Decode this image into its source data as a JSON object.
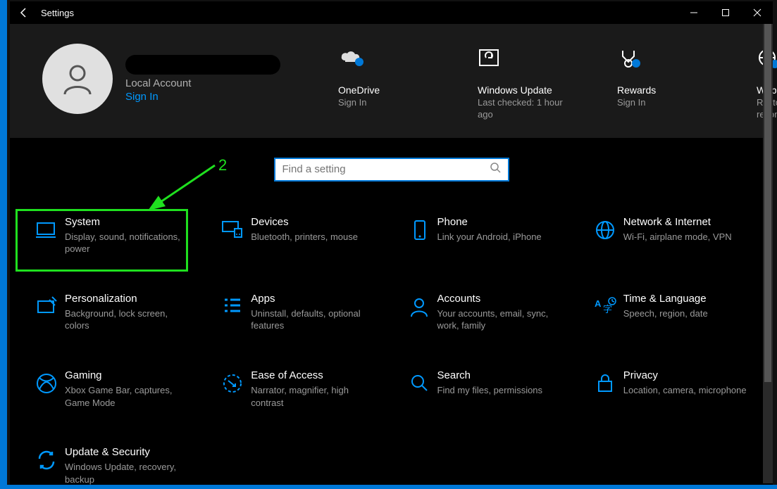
{
  "window": {
    "title": "Settings"
  },
  "user": {
    "account_type": "Local Account",
    "sign_in_label": "Sign In"
  },
  "status": [
    {
      "title": "OneDrive",
      "sub": "Sign In"
    },
    {
      "title": "Windows Update",
      "sub": "Last checked: 1 hour ago"
    },
    {
      "title": "Rewards",
      "sub": "Sign In"
    },
    {
      "title": "Web browsing",
      "sub": "Restore recommended"
    }
  ],
  "search": {
    "placeholder": "Find a setting"
  },
  "tiles": [
    {
      "title": "System",
      "sub": "Display, sound, notifications, power"
    },
    {
      "title": "Devices",
      "sub": "Bluetooth, printers, mouse"
    },
    {
      "title": "Phone",
      "sub": "Link your Android, iPhone"
    },
    {
      "title": "Network & Internet",
      "sub": "Wi-Fi, airplane mode, VPN"
    },
    {
      "title": "Personalization",
      "sub": "Background, lock screen, colors"
    },
    {
      "title": "Apps",
      "sub": "Uninstall, defaults, optional features"
    },
    {
      "title": "Accounts",
      "sub": "Your accounts, email, sync, work, family"
    },
    {
      "title": "Time & Language",
      "sub": "Speech, region, date"
    },
    {
      "title": "Gaming",
      "sub": "Xbox Game Bar, captures, Game Mode"
    },
    {
      "title": "Ease of Access",
      "sub": "Narrator, magnifier, high contrast"
    },
    {
      "title": "Search",
      "sub": "Find my files, permissions"
    },
    {
      "title": "Privacy",
      "sub": "Location, camera, microphone"
    },
    {
      "title": "Update & Security",
      "sub": "Windows Update, recovery, backup"
    }
  ],
  "annotation": {
    "label": "2"
  }
}
